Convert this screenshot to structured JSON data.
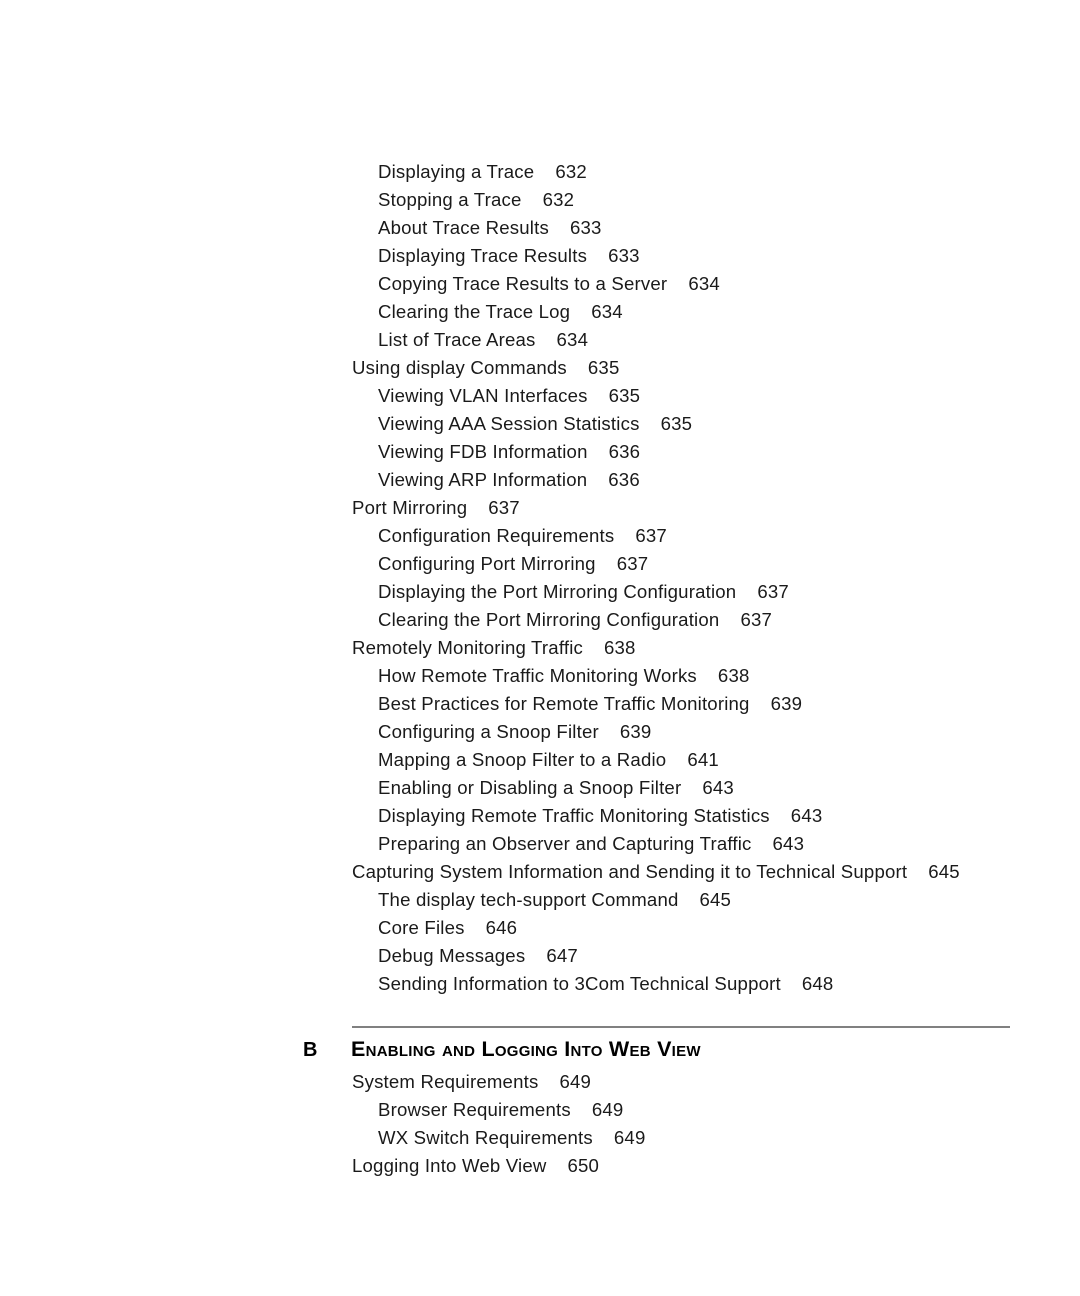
{
  "document": {
    "type": "table-of-contents",
    "text_color": "#1a1a1a",
    "rule_color": "#808080",
    "background": "#ffffff"
  },
  "toc_top": [
    {
      "level": 2,
      "title": "Displaying a Trace",
      "page": "632"
    },
    {
      "level": 2,
      "title": "Stopping a Trace",
      "page": "632"
    },
    {
      "level": 2,
      "title": "About Trace Results",
      "page": "633"
    },
    {
      "level": 2,
      "title": "Displaying Trace Results",
      "page": "633"
    },
    {
      "level": 2,
      "title": "Copying Trace Results to a Server",
      "page": "634"
    },
    {
      "level": 2,
      "title": "Clearing the Trace Log",
      "page": "634"
    },
    {
      "level": 2,
      "title": "List of Trace Areas",
      "page": "634"
    },
    {
      "level": 1,
      "title": "Using display Commands",
      "page": "635"
    },
    {
      "level": 2,
      "title": "Viewing VLAN Interfaces",
      "page": "635"
    },
    {
      "level": 2,
      "title": "Viewing AAA Session Statistics",
      "page": "635"
    },
    {
      "level": 2,
      "title": "Viewing FDB Information",
      "page": "636"
    },
    {
      "level": 2,
      "title": "Viewing ARP Information",
      "page": "636"
    },
    {
      "level": 1,
      "title": "Port Mirroring",
      "page": "637"
    },
    {
      "level": 2,
      "title": "Configuration Requirements",
      "page": "637"
    },
    {
      "level": 2,
      "title": "Configuring Port Mirroring",
      "page": "637"
    },
    {
      "level": 2,
      "title": "Displaying the Port Mirroring Configuration",
      "page": "637"
    },
    {
      "level": 2,
      "title": "Clearing the Port Mirroring Configuration",
      "page": "637"
    },
    {
      "level": 1,
      "title": "Remotely Monitoring Traffic",
      "page": "638"
    },
    {
      "level": 2,
      "title": "How Remote Traffic Monitoring Works",
      "page": "638"
    },
    {
      "level": 2,
      "title": "Best Practices for Remote Traffic Monitoring",
      "page": "639"
    },
    {
      "level": 2,
      "title": "Configuring a Snoop Filter",
      "page": "639"
    },
    {
      "level": 2,
      "title": "Mapping a Snoop Filter to a Radio",
      "page": "641"
    },
    {
      "level": 2,
      "title": "Enabling or Disabling a Snoop Filter",
      "page": "643"
    },
    {
      "level": 2,
      "title": "Displaying Remote Traffic Monitoring Statistics",
      "page": "643"
    },
    {
      "level": 2,
      "title": "Preparing an Observer and Capturing Traffic",
      "page": "643"
    },
    {
      "level": 1,
      "title": "Capturing System Information and Sending it to Technical Support",
      "page": "645"
    },
    {
      "level": 2,
      "title": "The display tech-support Command",
      "page": "645"
    },
    {
      "level": 2,
      "title": "Core Files",
      "page": "646"
    },
    {
      "level": 2,
      "title": "Debug Messages",
      "page": "647"
    },
    {
      "level": 2,
      "title": "Sending Information to 3Com Technical Support",
      "page": "648"
    }
  ],
  "chapter": {
    "letter": "B",
    "title": "Enabling and Logging Into Web View"
  },
  "toc_bottom": [
    {
      "level": 1,
      "title": "System Requirements",
      "page": "649"
    },
    {
      "level": 2,
      "title": "Browser Requirements",
      "page": "649"
    },
    {
      "level": 2,
      "title": "WX Switch Requirements",
      "page": "649"
    },
    {
      "level": 1,
      "title": "Logging Into Web View",
      "page": "650"
    }
  ]
}
